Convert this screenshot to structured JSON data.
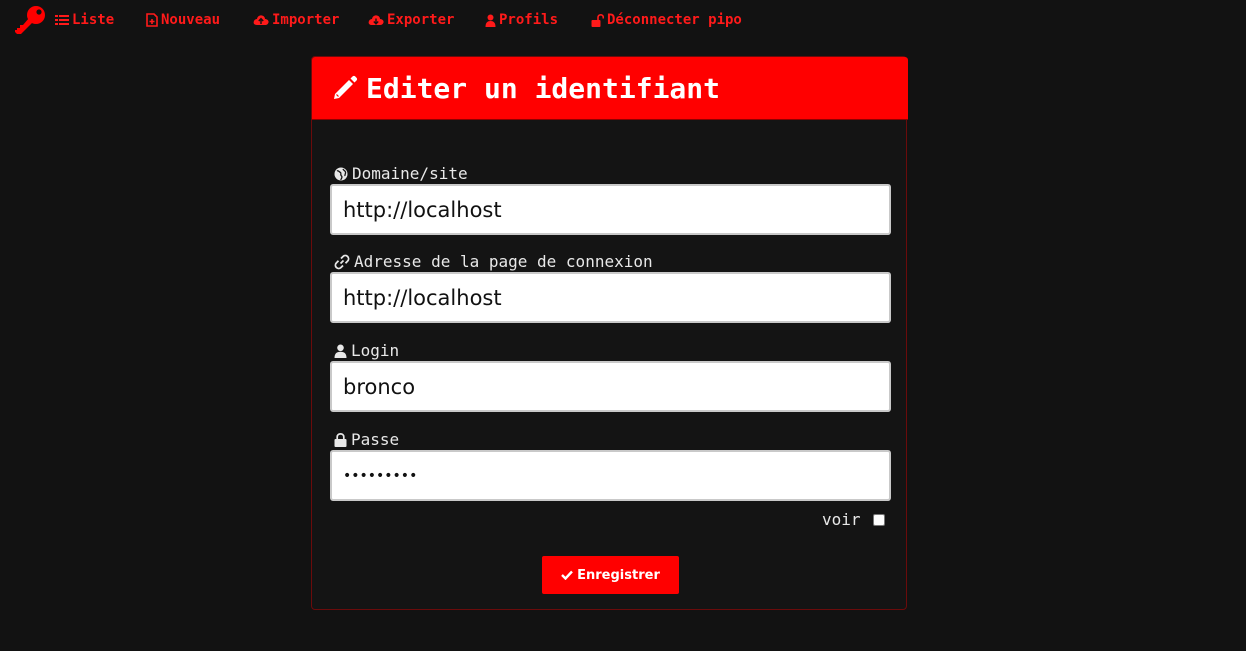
{
  "nav": {
    "brand_icon": "key-icon",
    "items": [
      {
        "label": "Liste",
        "icon": "list-icon"
      },
      {
        "label": "Nouveau",
        "icon": "new-file-icon"
      },
      {
        "label": "Importer",
        "icon": "cloud-upload-icon"
      },
      {
        "label": "Exporter",
        "icon": "cloud-download-icon"
      },
      {
        "label": "Profils",
        "icon": "user-icon"
      },
      {
        "label": "Déconnecter pipo",
        "icon": "unlock-icon"
      }
    ]
  },
  "form": {
    "title": "Editer un identifiant",
    "title_icon": "pencil-icon",
    "fields": {
      "domain": {
        "label": "Domaine/site",
        "icon": "globe-icon",
        "value": "http://localhost"
      },
      "login_page": {
        "label": "Adresse de la page de connexion",
        "icon": "link-icon",
        "value": "http://localhost"
      },
      "login": {
        "label": "Login",
        "icon": "user-icon",
        "value": "bronco"
      },
      "password": {
        "label": "Passe",
        "icon": "lock-icon",
        "value": "•••••••••"
      }
    },
    "show_password": {
      "label": "voir",
      "checked": false
    },
    "submit": {
      "label": "Enregistrer",
      "icon": "check-icon"
    }
  },
  "colors": {
    "accent": "#ff0000",
    "background": "#121212",
    "panel_border": "#6b0b0b"
  }
}
